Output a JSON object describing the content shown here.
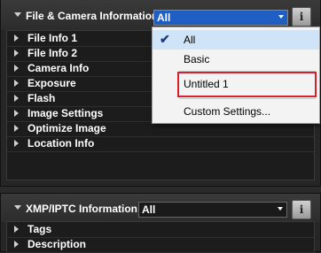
{
  "file_camera_panel": {
    "title": "File & Camera Information",
    "selected_option": "All",
    "info_icon": "info-icon",
    "sections": [
      "File Info 1",
      "File Info 2",
      "Camera Info",
      "Exposure",
      "Flash",
      "Image Settings",
      "Optimize Image",
      "Location Info"
    ]
  },
  "dropdown": {
    "items": [
      "All",
      "Basic",
      "Untitled 1",
      "Custom Settings..."
    ],
    "checked_item": "All",
    "highlighted_item": "Untitled 1"
  },
  "xmp_panel": {
    "title": "XMP/IPTC Information",
    "selected_option": "All",
    "info_icon": "info-icon",
    "sections": [
      "Tags",
      "Description"
    ]
  },
  "colors": {
    "select_accent": "#1f5fc4",
    "highlight_border": "#d8202a"
  }
}
